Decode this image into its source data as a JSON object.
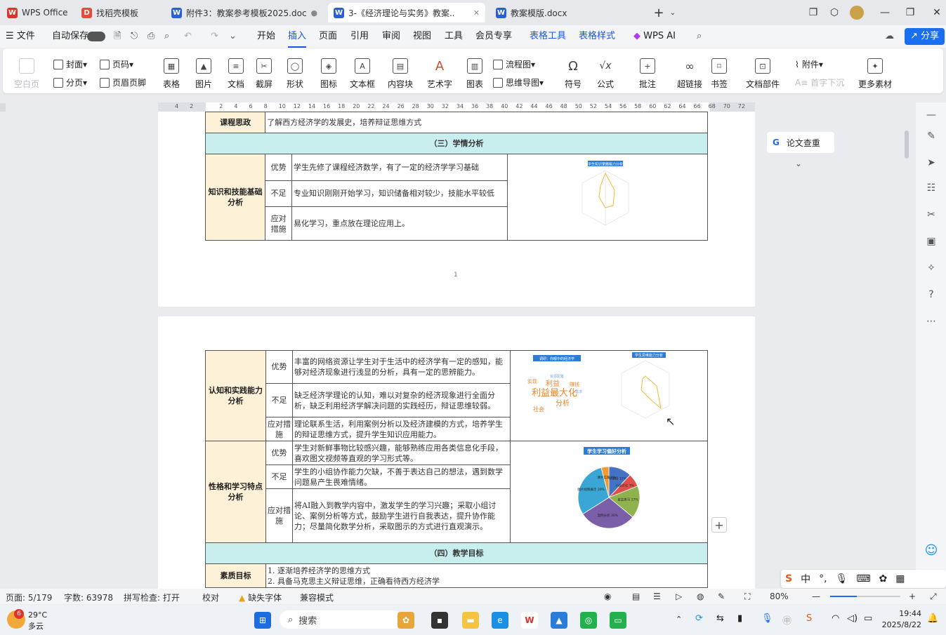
{
  "tabs": [
    {
      "label": "WPS Office",
      "color": "#e0312b",
      "glyph": "W"
    },
    {
      "label": "找稻壳模板",
      "color": "#e8493b",
      "glyph": "D"
    },
    {
      "label": "附件3：教案参考模板2025.doc",
      "color": "#2b5fd9",
      "glyph": "W"
    },
    {
      "label": "3-《经济理论与实务》教案...",
      "color": "#2b5fd9",
      "glyph": "W"
    },
    {
      "label": "教案模版.docx",
      "color": "#2b5fd9",
      "glyph": "W"
    }
  ],
  "menu": {
    "file": "文件",
    "autosave": "自动保存",
    "items": [
      "开始",
      "插入",
      "页面",
      "引用",
      "审阅",
      "视图",
      "工具",
      "会员专享"
    ],
    "table_tools": "表格工具",
    "table_style": "表格样式",
    "ai": "WPS AI",
    "share": "分享"
  },
  "ribbon": {
    "blank": "空白页",
    "cover": "封面",
    "pageno": "页码",
    "pagebreak": "分页",
    "header_footer": "页眉页脚",
    "table": "表格",
    "picture": "图片",
    "doc": "文档",
    "screenshot": "截屏",
    "shape": "形状",
    "icon": "图标",
    "textbox": "文本框",
    "content": "内容块",
    "arttext": "艺术字",
    "chart": "图表",
    "flowchart": "流程图",
    "mindmap": "思维导图",
    "symbol": "符号",
    "formula": "公式",
    "comment": "批注",
    "hyperlink": "超链接",
    "bookmark": "书签",
    "docpart": "文档部件",
    "attachment": "附件",
    "initial": "首字下沉",
    "more": "更多素材"
  },
  "ruler_ticks": [
    "4",
    "2",
    "",
    "2",
    "4",
    "6",
    "8",
    "10",
    "12",
    "14",
    "16",
    "18",
    "20",
    "22",
    "24",
    "26",
    "28",
    "30",
    "32",
    "34",
    "36",
    "38",
    "40",
    "42",
    "44",
    "46",
    "48",
    "50",
    "52",
    "54",
    "56",
    "58",
    "60",
    "62",
    "64",
    "66",
    "68",
    "70",
    "72"
  ],
  "page1": {
    "row_label": "课程思政",
    "row_text": "了解西方经济学的发展史，培养辩证思维方式",
    "section": "（三）学情分析",
    "group": "知识和技能基础分析",
    "rows": [
      {
        "k": "优势",
        "v": "学生先修了课程经济数学，有了一定的经济学学习基础"
      },
      {
        "k": "不足",
        "v": "专业知识刚刚开始学习，知识储备相对较少，技能水平较低"
      },
      {
        "k": "应对措施",
        "v": "易化学习，重点放在理论应用上。"
      }
    ],
    "radar_title": "学生知识掌握能力分析",
    "page_no": "1"
  },
  "page2": {
    "group1": "认知和实践能力分析",
    "rows1": [
      {
        "k": "优势",
        "v": "丰富的网络资源让学生对于生活中的经济学有一定的感知，能够对经济现象进行浅显的分析，具有一定的思辨能力。"
      },
      {
        "k": "不足",
        "v": "缺乏经济学理论的认知，难以对复杂的经济现象进行全面分析，缺乏利用经济学解决问题的实践经历，辩证思维较弱。"
      },
      {
        "k": "应对措施",
        "v": "理论联系生活，利用案例分析以及经济建模的方式，培养学生的辩证思维方式，提升学生知识应用能力。"
      }
    ],
    "wordcloud_title": "调研：你眼中的经济学",
    "wordcloud_words": [
      "利益最大化",
      "利益",
      "分析",
      "实现",
      "赚钱",
      "社会",
      "资源配置",
      "需求"
    ],
    "radar2_title": "学生思维能力分析",
    "group2": "性格和学习特点分析",
    "rows2": [
      {
        "k": "优势",
        "v": "学生对新鲜事物比较感兴趣，能够熟练应用各类信息化手段，喜欢图文视频等直观的学习形式等。"
      },
      {
        "k": "不足",
        "v": "学生的小组协作能力欠缺，不善于表达自己的想法，遇到数学问题易产生畏难情绪。"
      },
      {
        "k": "应对措施",
        "v": "将AI融入到教学内容中，激发学生的学习兴趣；采取小组讨论、案例分析等方式，鼓励学生进行自我表达，提升协作能力；尽量简化数学分析，采取图示的方式进行直观演示。"
      }
    ],
    "pie_title": "学生学习偏好分析",
    "pie": [
      {
        "label": "教师讲授",
        "value": 12,
        "color": "#4472c4"
      },
      {
        "label": "小组讨论",
        "value": 7,
        "color": "#e0504a"
      },
      {
        "label": "自主练习",
        "value": 17,
        "color": "#8fb14e"
      },
      {
        "label": "案例分析",
        "value": 30,
        "color": "#7b5ea8"
      },
      {
        "label": "图片视频展示",
        "value": 30,
        "color": "#3aa6d6"
      },
      {
        "label": "课外实践",
        "value": 4,
        "color": "#f39a2e"
      }
    ],
    "section2": "（四）教学目标",
    "goal_label": "素质目标",
    "goals": [
      "1. 逐渐培养经济学的思维方式",
      "2. 具备马克思主义辩证思维，正确看待西方经济学"
    ]
  },
  "check": "论文查重",
  "status": {
    "page": "页面: 5/179",
    "words": "字数: 63978",
    "spell": "拼写检查: 打开",
    "proof": "校对",
    "missing_font": "缺失字体",
    "compat": "兼容模式",
    "zoom": "80%"
  },
  "taskbar": {
    "temp": "29°C",
    "weather": "多云",
    "badge": "6",
    "search": "搜索",
    "ime": "中",
    "time": "19:44",
    "date": "2025/8/22"
  }
}
